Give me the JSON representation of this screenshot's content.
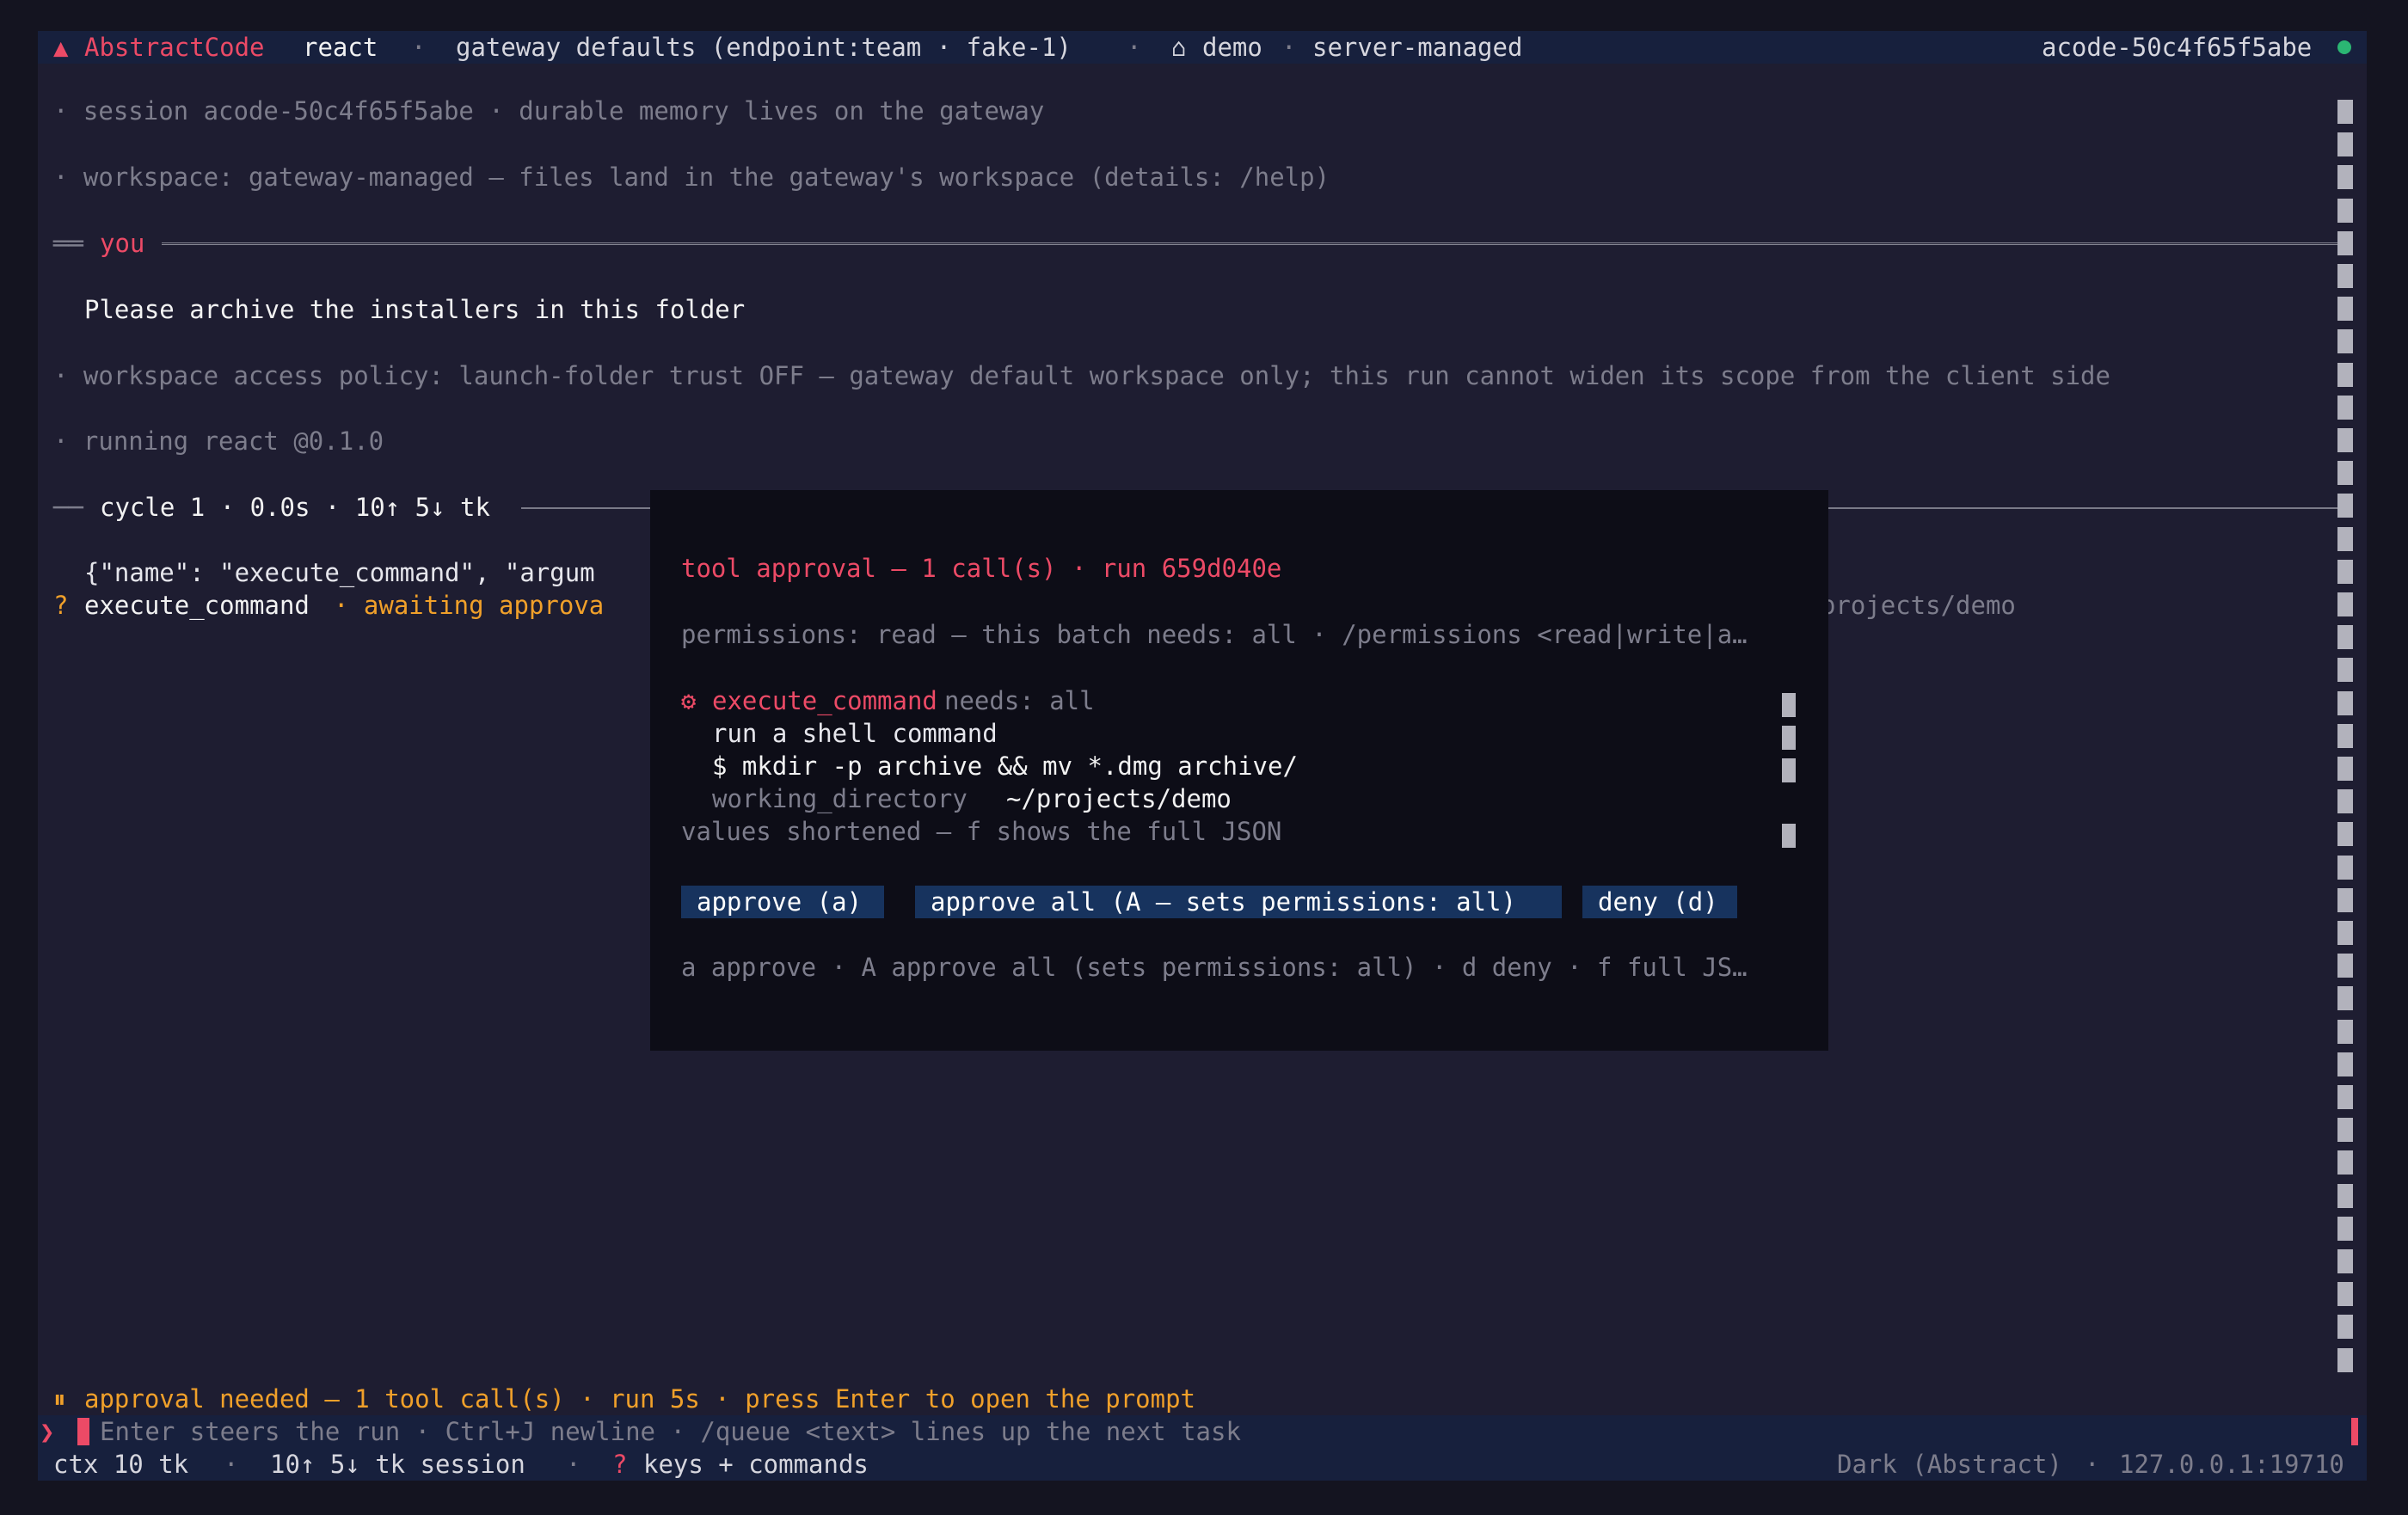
{
  "header": {
    "brand_icon": "▲",
    "brand": "AbstractCode",
    "agent": "react",
    "sep1": "·",
    "gateway": "gateway defaults (endpoint:team · fake-1)",
    "sep2": "·",
    "home_icon": "⌂",
    "workspace": "demo",
    "sep3": "·",
    "mode": "server-managed",
    "session_id": "acode-50c4f65f5abe",
    "status_color": "#2bb673"
  },
  "transcript": {
    "session_line": "· session acode-50c4f65f5abe · durable memory lives on the gateway",
    "workspace_line": "· workspace: gateway-managed — files land in the gateway's workspace (details: /help)",
    "you_prefix": "══",
    "you_label": "you",
    "user_message": "Please archive the installers in this folder",
    "policy_line": "· workspace access policy: launch-folder trust OFF — gateway default workspace only; this run cannot widen its scope from the client side",
    "running_line": "· running react @0.1.0",
    "cycle_prefix": "──",
    "cycle_label": "cycle 1 · 0.0s · 10↑ 5↓ tk",
    "json_line": "{\"name\": \"execute_command\", \"argum",
    "pending_mark": "?",
    "pending_tool": "execute_command",
    "pending_status": "· awaiting approva",
    "cwd_tail": "~/projects/demo"
  },
  "approval": {
    "title": "tool approval — 1 call(s) · run 659d040e",
    "permissions_line": "permissions: read — this batch needs: all · /permissions <read|write|a…",
    "tool_icon": "⚙",
    "tool_name": "execute_command",
    "needs": "needs: all",
    "description": "run a shell command",
    "command": "$ mkdir -p archive && mv *.dmg archive/",
    "arg_key": "working_directory",
    "arg_value": "~/projects/demo",
    "shortened_note": "values shortened — f shows the full JSON",
    "btn_approve": "approve (a)",
    "btn_approve_all": "approve all (A — sets permissions: all)",
    "btn_deny": "deny (d)",
    "keys_hint": "a approve · A approve all (sets permissions: all) · d deny · f full JS…"
  },
  "status": {
    "pause_icon": "⏸",
    "approval_needed": "approval needed — 1 tool call(s) · run 5s · press Enter to open the prompt"
  },
  "input": {
    "prompt_icon": "❯",
    "placeholder": "Enter steers the run · Ctrl+J newline · /queue <text> lines up the next task"
  },
  "footer": {
    "ctx": "ctx 10 tk",
    "sep1": "·",
    "session_tokens": "10↑ 5↓ tk session",
    "sep2": "·",
    "help_icon": "?",
    "keys": "keys + commands",
    "theme": "Dark (Abstract)",
    "sep3": "·",
    "address": "127.0.0.1:19710"
  }
}
